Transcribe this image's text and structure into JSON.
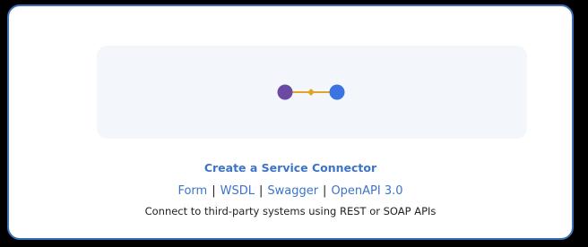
{
  "card": {
    "title": "Create a Service Connector",
    "links": [
      "Form",
      "WSDL",
      "Swagger",
      "OpenAPI 3.0"
    ],
    "separator": "|",
    "description": "Connect to third-party systems using REST or SOAP APIs"
  },
  "illustration": {
    "left_node_icon": "purple-circle",
    "middle_icon": "diamond",
    "right_node_icon": "blue-circle"
  },
  "colors": {
    "accent": "#3c74c9",
    "card_border": "#3c6fb5",
    "node_left": "#6a4aa3",
    "node_right": "#3b74e0",
    "link_line": "#e3a327",
    "illustration_bg": "#f3f6fb"
  }
}
